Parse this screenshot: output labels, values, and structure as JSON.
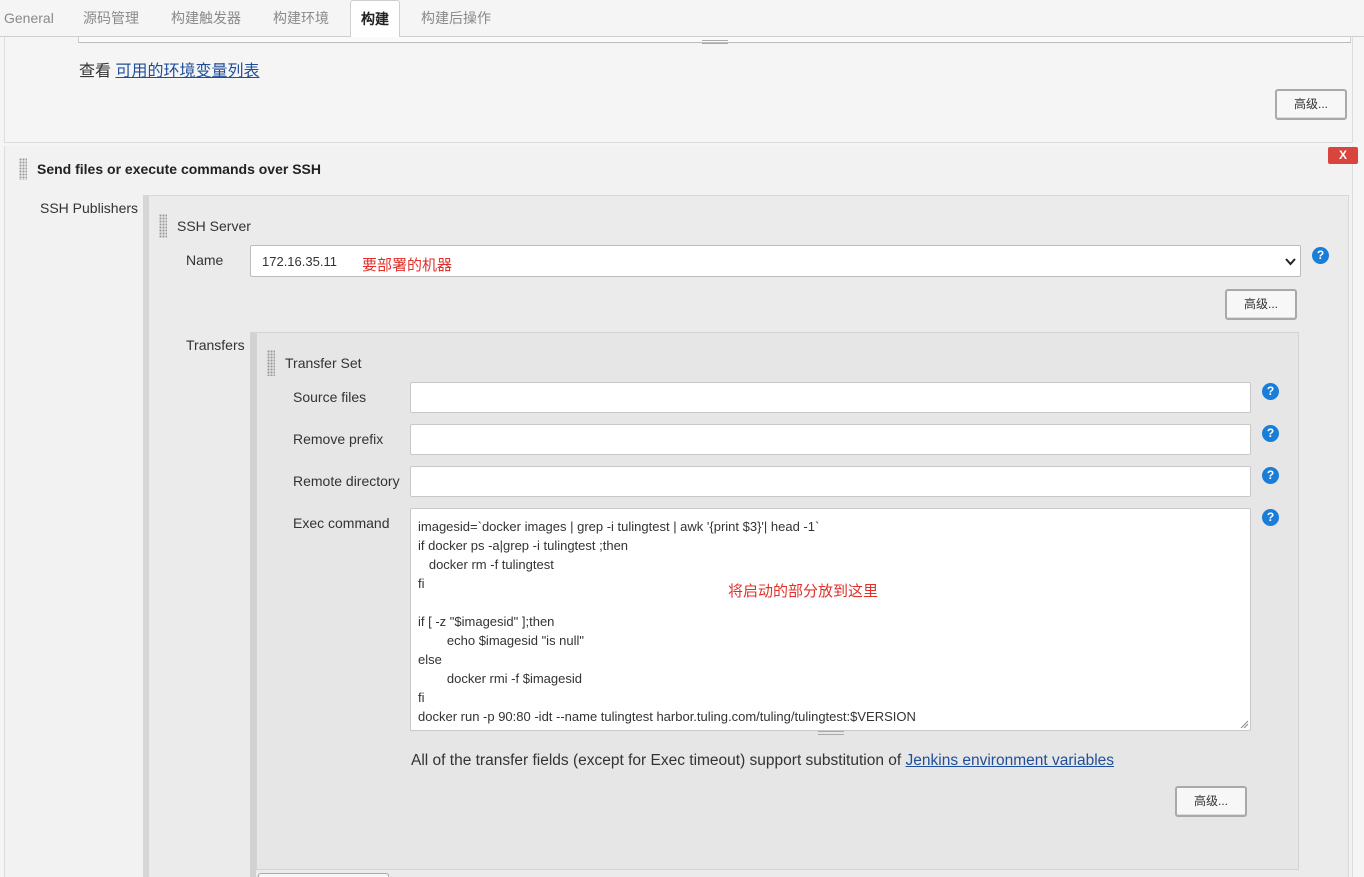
{
  "tabs": [
    {
      "label": "General",
      "active": false
    },
    {
      "label": "源码管理",
      "active": false
    },
    {
      "label": "构建触发器",
      "active": false
    },
    {
      "label": "构建环境",
      "active": false
    },
    {
      "label": "构建",
      "active": true
    },
    {
      "label": "构建后操作",
      "active": false
    }
  ],
  "top": {
    "view_prefix": "查看",
    "env_link": "可用的环境变量列表",
    "advanced_label": "高级..."
  },
  "ssh": {
    "section_title": "Send files or execute commands over SSH",
    "delete_label": "X",
    "publishers_label": "SSH Publishers",
    "server_title": "SSH Server",
    "name_label": "Name",
    "name_value": "172.16.35.11",
    "name_annotation": "要部署的机器",
    "advanced_label": "高级...",
    "transfers_label": "Transfers",
    "transfer_set_title": "Transfer Set",
    "source_files_label": "Source files",
    "source_files_value": "",
    "remove_prefix_label": "Remove prefix",
    "remove_prefix_value": "",
    "remote_directory_label": "Remote directory",
    "remote_directory_value": "",
    "exec_command_label": "Exec command",
    "exec_lines": [
      "imagesid=`docker images | grep -i tulingtest | awk '{print $3}'| head -1`",
      "if docker ps -a|grep -i tulingtest ;then",
      "   docker rm -f tulingtest",
      "fi",
      "",
      "if [ -z \"$imagesid\" ];then",
      "        echo $imagesid \"is null\"",
      "else",
      "        docker rmi -f $imagesid",
      "fi",
      "docker run -p 90:80 -idt --name tulingtest harbor.tuling.com/tuling/tulingtest:$VERSION"
    ],
    "exec_annotation": "将启动的部分放到这里",
    "substitution_note": "All of the transfer fields (except for Exec timeout) support substitution of",
    "substitution_link": "Jenkins environment variables",
    "transfer_advanced_label": "高级...",
    "help_glyph": "?"
  },
  "colors": {
    "link": "#1f4e9a",
    "help": "#1a7dd7",
    "annotation": "#e0302a",
    "delete": "#d9443c"
  }
}
